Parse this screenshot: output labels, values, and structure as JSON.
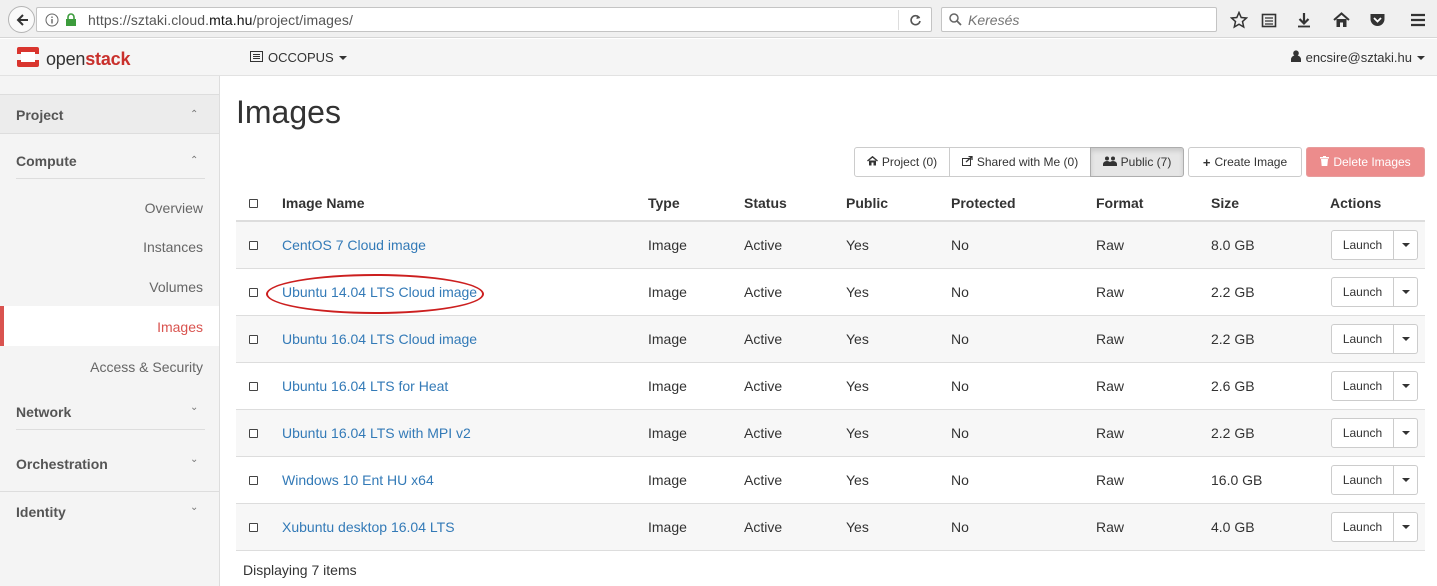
{
  "browser": {
    "url_prefix": "https://sztaki.cloud.",
    "url_domain": "mta.hu",
    "url_path": "/project/images/",
    "search_placeholder": "Keresés"
  },
  "header": {
    "logo_open": "open",
    "logo_stack": "stack",
    "project": "OCCOPUS",
    "user": "encsire@sztaki.hu"
  },
  "sidebar": {
    "project": "Project",
    "compute": "Compute",
    "items": [
      "Overview",
      "Instances",
      "Volumes",
      "Images",
      "Access & Security"
    ],
    "active_item": "Images",
    "network": "Network",
    "orchestration": "Orchestration",
    "identity": "Identity"
  },
  "main": {
    "title": "Images",
    "filters": {
      "project": "Project (0)",
      "shared": "Shared with Me (0)",
      "public": "Public (7)"
    },
    "create_label": "Create Image",
    "delete_label": "Delete Images",
    "columns": [
      "Image Name",
      "Type",
      "Status",
      "Public",
      "Protected",
      "Format",
      "Size",
      "Actions"
    ],
    "rows": [
      {
        "name": "CentOS 7 Cloud image",
        "type": "Image",
        "status": "Active",
        "public": "Yes",
        "protected": "No",
        "format": "Raw",
        "size": "8.0 GB",
        "action": "Launch"
      },
      {
        "name": "Ubuntu 14.04 LTS Cloud image",
        "type": "Image",
        "status": "Active",
        "public": "Yes",
        "protected": "No",
        "format": "Raw",
        "size": "2.2 GB",
        "action": "Launch"
      },
      {
        "name": "Ubuntu 16.04 LTS Cloud image",
        "type": "Image",
        "status": "Active",
        "public": "Yes",
        "protected": "No",
        "format": "Raw",
        "size": "2.2 GB",
        "action": "Launch"
      },
      {
        "name": "Ubuntu 16.04 LTS for Heat",
        "type": "Image",
        "status": "Active",
        "public": "Yes",
        "protected": "No",
        "format": "Raw",
        "size": "2.6 GB",
        "action": "Launch"
      },
      {
        "name": "Ubuntu 16.04 LTS with MPI v2",
        "type": "Image",
        "status": "Active",
        "public": "Yes",
        "protected": "No",
        "format": "Raw",
        "size": "2.2 GB",
        "action": "Launch"
      },
      {
        "name": "Windows 10 Ent HU x64",
        "type": "Image",
        "status": "Active",
        "public": "Yes",
        "protected": "No",
        "format": "Raw",
        "size": "16.0 GB",
        "action": "Launch"
      },
      {
        "name": "Xubuntu desktop 16.04 LTS",
        "type": "Image",
        "status": "Active",
        "public": "Yes",
        "protected": "No",
        "format": "Raw",
        "size": "4.0 GB",
        "action": "Launch"
      }
    ],
    "footer": "Displaying 7 items"
  },
  "colors": {
    "accent_red": "#d9534f",
    "link_blue": "#337ab7",
    "annotation_red": "#cc1f1f"
  }
}
